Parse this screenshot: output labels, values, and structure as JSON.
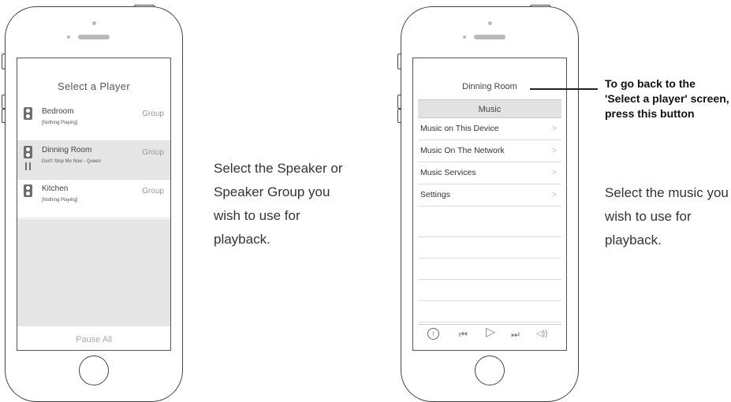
{
  "left_screen": {
    "title": "Select a Player",
    "players": [
      {
        "name": "Bedroom",
        "status": "[Nothing Playing]",
        "group_label": "Group"
      },
      {
        "name": "Dinning Room",
        "status": "Don't Stop Me Now - Queen",
        "group_label": "Group"
      },
      {
        "name": "Kitchen",
        "status": "[Nothing Playing]",
        "group_label": "Group"
      }
    ],
    "pause_all": "Pause All"
  },
  "left_instruction": "Select the Speaker or Speaker Group you wish to use for playback.",
  "right_screen": {
    "room_title": "Dinning Room",
    "section_title": "Music",
    "menu": [
      {
        "label": "Music on This Device",
        "chevron": ">"
      },
      {
        "label": "Music On The Network",
        "chevron": ">"
      },
      {
        "label": "Music Services",
        "chevron": ">"
      },
      {
        "label": "Settings",
        "chevron": ">"
      }
    ],
    "controls": {
      "up": "↑",
      "prev": "⏮",
      "play": "▷",
      "next": "⏭",
      "volume": "◁))"
    }
  },
  "callout": "To go back to the 'Select a player' screen, press this button",
  "right_instruction": "Select the music you wish to use for playback."
}
